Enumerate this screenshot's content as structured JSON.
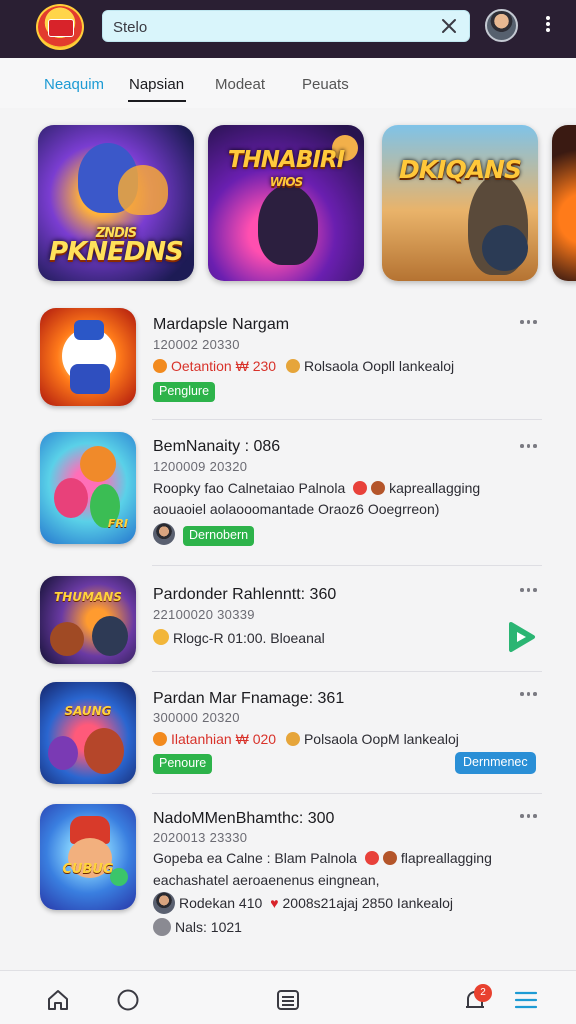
{
  "app": {
    "logo_text": "",
    "accent_color": "#1d9bd4",
    "topbar_color": "#2a1f33"
  },
  "search": {
    "value": "Stelo",
    "placeholder": "Stelo"
  },
  "tabs": [
    {
      "label": "Neaquim",
      "state": "highlighted"
    },
    {
      "label": "Napsian",
      "state": "selected"
    },
    {
      "label": "Modeat",
      "state": "normal"
    },
    {
      "label": "Peuats",
      "state": "normal"
    }
  ],
  "featured": [
    {
      "art_title": "PKNEDNS",
      "art_subtitle": "ZNDIS"
    },
    {
      "art_title": "THNABIRI",
      "art_subtitle": "WIOS"
    },
    {
      "art_title": "DKIQANS",
      "art_subtitle": ""
    }
  ],
  "list": [
    {
      "title": "Mardapsle Nargam",
      "date": "120002 20330",
      "line1_prefix": "Oetantion ₩ 230",
      "line1_suffix": "Rolsaola Oopll lankealoj",
      "badge": "Penglure",
      "thumb_text": ""
    },
    {
      "title": "BemNanaity : 086",
      "date": "1200009 20320",
      "line1": "Roopky fao Calnetaiao Palnola",
      "line1_suffix": "kapreallagging",
      "line2": "aouaoiel aolaooomantade Oraoz6 Ooegrreon)",
      "badge": "Dernobern",
      "thumb_text": "FRI"
    },
    {
      "title": "Pardonder Rahlenntt: 360",
      "date": "22100020 30339",
      "line1": "Rlogc-R 01:00. Bloeanal",
      "thumb_text": "THUMANS"
    },
    {
      "title": "Pardan Mar Fnamage: 361",
      "date": "300000 20320",
      "line1_prefix": "Ilatanhian ₩ 020",
      "line1_suffix": "Polsaola OopM lankealoj",
      "badge": "Penoure",
      "badge_right": "Dernmenec",
      "thumb_text": "SAUNG"
    },
    {
      "title": "NadoMMenBhamthc: 300",
      "date": "2020013 23330",
      "line1": "Gopeba ea Calne : Blam Palnola",
      "line1_suffix": "flapreallagging",
      "line2": "eachashatel aeroaenenus eingnean,",
      "line3_prefix": "Rodekan 410",
      "line3_suffix": "2008s21ajaj 2850 Iankealoj",
      "line4": "Nals: 1021",
      "thumb_text": "CUBUG"
    }
  ],
  "bottom_nav": {
    "notification_count": "2"
  }
}
